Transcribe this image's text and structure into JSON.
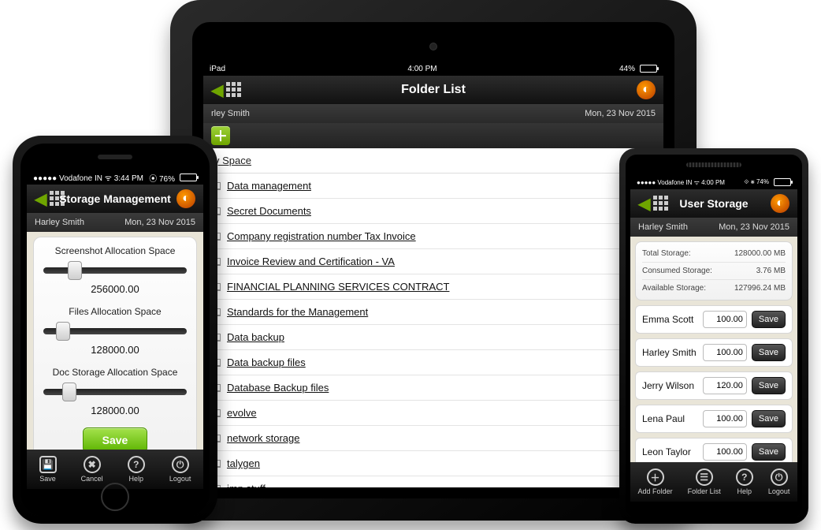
{
  "ipad": {
    "statusbar": {
      "device": "iPad",
      "wifi": "✦",
      "time": "4:00 PM",
      "battery_pct": "44%",
      "battery_fill": 44
    },
    "header": {
      "title": "Folder List"
    },
    "user": "rley Smith",
    "date": "Mon, 23 Nov 2015",
    "space_title": "y Space",
    "folders": [
      "Data management",
      "Secret Documents",
      "Company registration number Tax Invoice",
      "Invoice Review and Certification - VA",
      "FINANCIAL PLANNING SERVICES CONTRACT",
      "Standards for the Management",
      "Data backup",
      "Data backup files",
      "Database Backup files",
      "evolve",
      "network storage",
      "talygen",
      "imp stuff"
    ]
  },
  "iphone": {
    "statusbar": {
      "left": "●●●●● Vodafone IN ᯤ 3:44 PM",
      "right": "⦿ 76%",
      "battery_fill": 76
    },
    "header": {
      "title": "Storage Management"
    },
    "user": "Harley Smith",
    "date": "Mon, 23 Nov 2015",
    "sections": [
      {
        "title": "Screenshot Allocation Space",
        "value": "256000.00",
        "thumb": 22
      },
      {
        "title": "Files Allocation Space",
        "value": "128000.00",
        "thumb": 14
      },
      {
        "title": "Doc Storage Allocation Space",
        "value": "128000.00",
        "thumb": 18
      }
    ],
    "save_label": "Save",
    "tabs": [
      {
        "icon": "💾",
        "label": "Save"
      },
      {
        "icon": "✖",
        "label": "Cancel"
      },
      {
        "icon": "?",
        "label": "Help"
      },
      {
        "icon": "⏻",
        "label": "Logout"
      }
    ]
  },
  "android": {
    "statusbar": {
      "left": "●●●●● Vodafone IN ᯤ 4:00 PM",
      "right": "⟐ ⨳ 74%",
      "battery_fill": 74
    },
    "header": {
      "title": "User Storage"
    },
    "user": "Harley Smith",
    "date": "Mon, 23 Nov 2015",
    "info": [
      {
        "label": "Total Storage:",
        "value": "128000.00 MB"
      },
      {
        "label": "Consumed Storage:",
        "value": "3.76 MB"
      },
      {
        "label": "Available Storage:",
        "value": "127996.24 MB"
      }
    ],
    "users": [
      {
        "name": "Emma Scott",
        "alloc": "100.00"
      },
      {
        "name": "Harley Smith",
        "alloc": "100.00"
      },
      {
        "name": "Jerry Wilson",
        "alloc": "120.00"
      },
      {
        "name": "Lena Paul",
        "alloc": "100.00"
      },
      {
        "name": "Leon Taylor",
        "alloc": "100.00"
      }
    ],
    "save_btn": "Save",
    "tabs": [
      {
        "icon": "＋",
        "label": "Add Folder"
      },
      {
        "icon": "☰",
        "label": "Folder List"
      },
      {
        "icon": "?",
        "label": "Help"
      },
      {
        "icon": "⏻",
        "label": "Logout"
      }
    ]
  }
}
